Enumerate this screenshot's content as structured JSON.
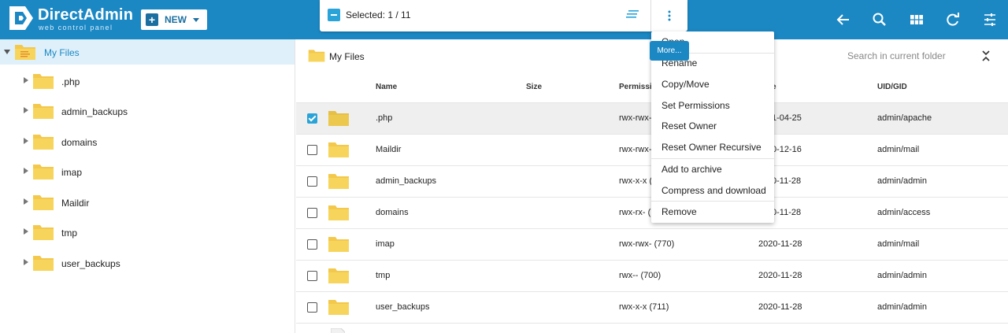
{
  "app": {
    "logo_title": "DirectAdmin",
    "logo_subtitle": "web control panel",
    "brand_color": "#1b88c4",
    "new_button_label": "NEW"
  },
  "selection": {
    "text": "Selected: 1 / 11",
    "more_tooltip": "More..."
  },
  "toolbar_icons": [
    "back-arrow-icon",
    "search-icon",
    "grid-view-icon",
    "refresh-icon",
    "settings-sliders-icon"
  ],
  "sidebar": {
    "root_label": "My Files",
    "items": [
      ".php",
      "admin_backups",
      "domains",
      "imap",
      "Maildir",
      "tmp",
      "user_backups"
    ]
  },
  "main": {
    "breadcrumb": "My Files",
    "search_placeholder": "Search in current folder",
    "columns": {
      "name": "Name",
      "size": "Size",
      "permissions": "Permissi",
      "date": "e",
      "uid": "UID/GID"
    },
    "rows": [
      {
        "name": ".php",
        "size": "",
        "perm": "rwx-rwx-",
        "date": "1-04-25",
        "uid": "admin/apache",
        "selected": true
      },
      {
        "name": "Maildir",
        "size": "",
        "perm": "rwx-rwx-",
        "date": "0-12-16",
        "uid": "admin/mail",
        "selected": false
      },
      {
        "name": "admin_backups",
        "size": "",
        "perm": "rwx-x-x (",
        "date": "0-11-28",
        "uid": "admin/admin",
        "selected": false
      },
      {
        "name": "domains",
        "size": "",
        "perm": "rwx-rx- (7",
        "date": "0-11-28",
        "uid": "admin/access",
        "selected": false
      },
      {
        "name": "imap",
        "size": "",
        "perm": "rwx-rwx- (770)",
        "date": "2020-11-28",
        "uid": "admin/mail",
        "selected": false
      },
      {
        "name": "tmp",
        "size": "",
        "perm": "rwx-- (700)",
        "date": "2020-11-28",
        "uid": "admin/admin",
        "selected": false
      },
      {
        "name": "user_backups",
        "size": "",
        "perm": "rwx-x-x (711)",
        "date": "2020-11-28",
        "uid": "admin/admin",
        "selected": false
      }
    ]
  },
  "menu": {
    "items": [
      "Open",
      "Rename",
      "Copy/Move",
      "Set Permissions",
      "Reset Owner",
      "Reset Owner Recursive",
      "Add to archive",
      "Compress and download",
      "Remove"
    ]
  }
}
